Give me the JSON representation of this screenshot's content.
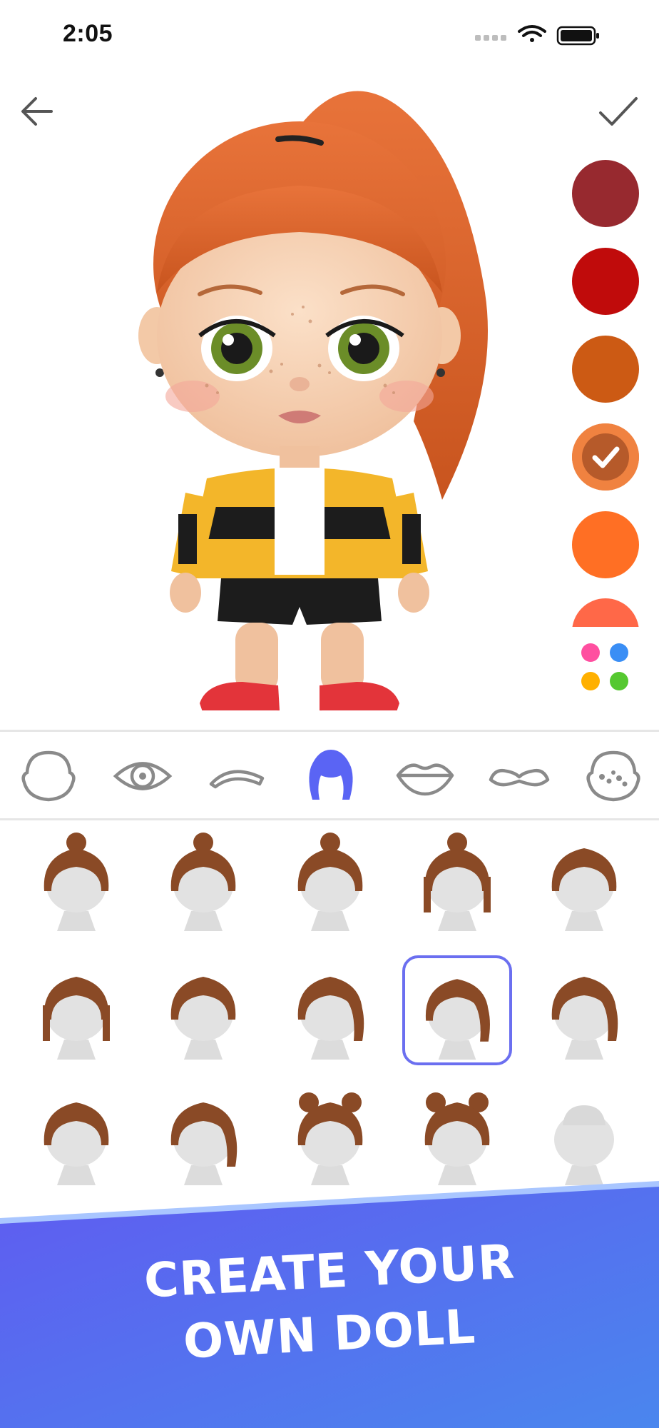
{
  "status": {
    "time": "2:05"
  },
  "palette": {
    "colors": [
      "#97292f",
      "#c00b0b",
      "#cc5a14",
      "#f08240",
      "#ff6f24",
      "#ff6848"
    ],
    "selected_index": 3,
    "more_colors_dots": [
      "#ff4fa0",
      "#3a8ef5",
      "#ffb000",
      "#55c830"
    ]
  },
  "categories": [
    {
      "icon": "face-shape-icon"
    },
    {
      "icon": "eye-icon"
    },
    {
      "icon": "eyebrow-icon"
    },
    {
      "icon": "hair-icon",
      "active": true
    },
    {
      "icon": "lips-icon"
    },
    {
      "icon": "mustache-icon"
    },
    {
      "icon": "freckles-icon"
    }
  ],
  "hair_grid": {
    "selected_index": 8,
    "count": 15
  },
  "banner": {
    "line1": "CREATE YOUR",
    "line2": "OWN DOLL"
  },
  "accent_color": "#5a64f4"
}
